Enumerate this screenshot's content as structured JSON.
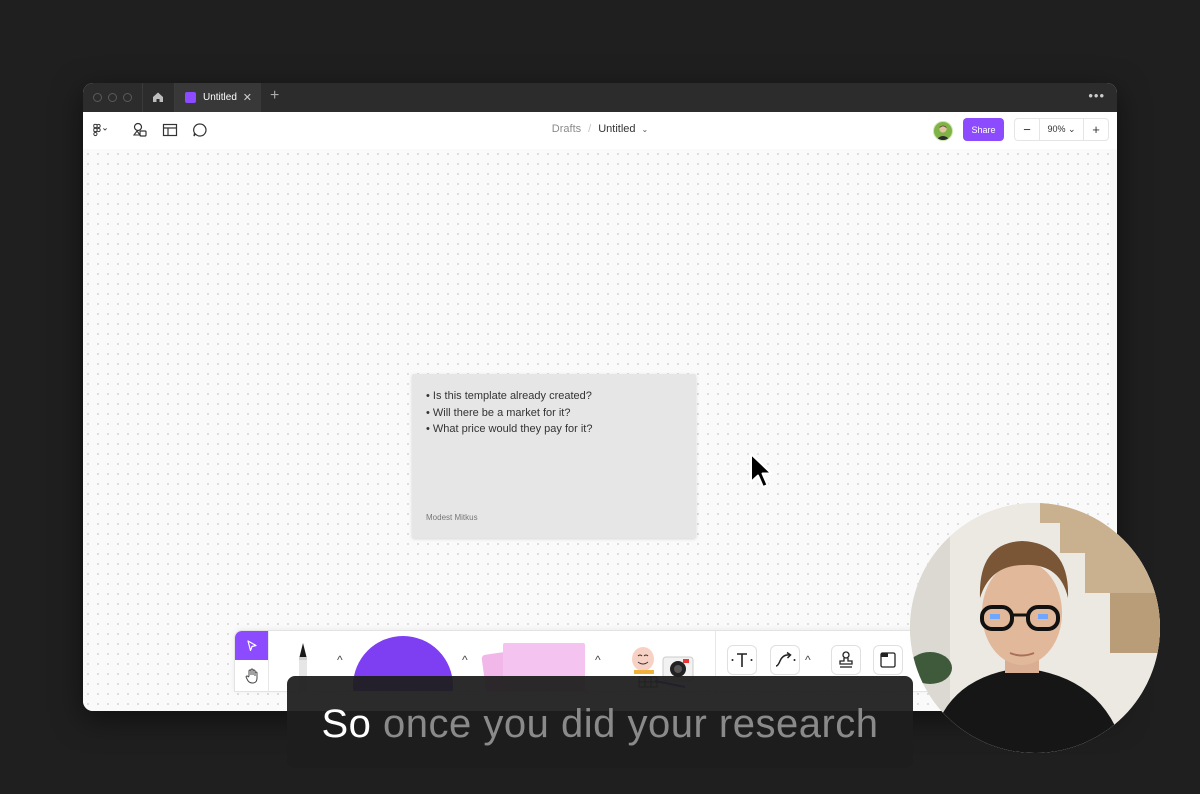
{
  "tabbar": {
    "tab_title": "Untitled",
    "tab_close": "✕",
    "new_tab": "+",
    "more": "•••"
  },
  "toolbar": {
    "breadcrumb_drafts": "Drafts",
    "breadcrumb_sep": "/",
    "file_title": "Untitled",
    "title_chevron": "⌄",
    "share_label": "Share",
    "zoom_out": "−",
    "zoom_level": "90% ⌄",
    "zoom_in": "+"
  },
  "card": {
    "items": [
      "• Is this template already created?",
      "• Will there be a market for it?",
      "• What price would they pay for it?"
    ],
    "author": "Modest Mitkus"
  },
  "dock": {
    "caret": "^"
  },
  "subtitle": {
    "spoken": "So",
    "upcoming": " once you did your research"
  },
  "colors": {
    "accent": "#8c4bff",
    "shape_fill": "#7e3ff2",
    "sticky_pink": "#f5c3ef",
    "card_bg": "#e6e6e6",
    "app_bg": "#1f1f1f"
  }
}
